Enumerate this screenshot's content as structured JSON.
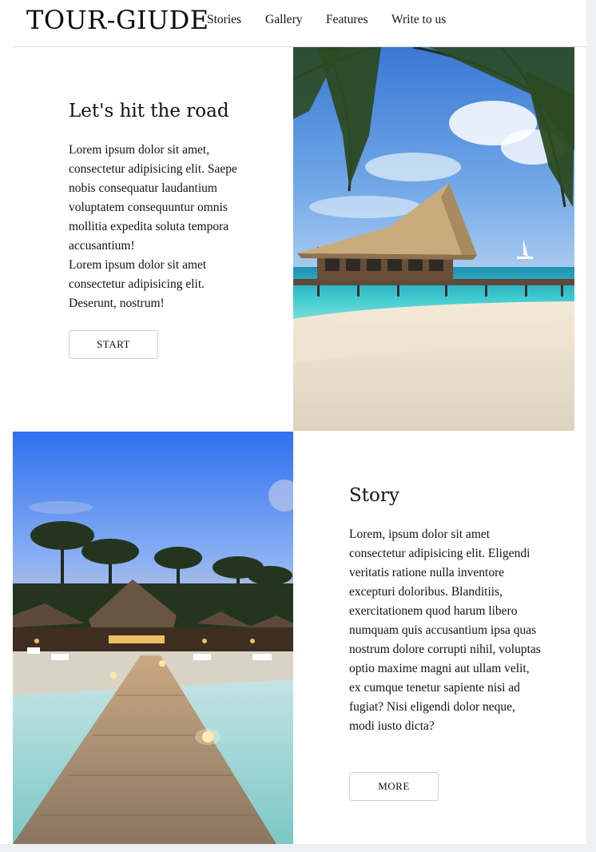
{
  "header": {
    "logo": "TOUR-GIUDE",
    "nav": [
      "Stories",
      "Gallery",
      "Features",
      "Write to us"
    ]
  },
  "hero": {
    "title": "Let's hit the road",
    "body": "Lorem ipsum dolor sit amet, consectetur adipisicing elit. Saepe nobis consequatur laudantium voluptatem consequuntur omnis mollitia expedita soluta tempora accusantium!\nLorem ipsum dolor sit amet consectetur adipisicing elit. Deserunt, nostrum!",
    "button": "START",
    "image": "beach-hut-pier-photo"
  },
  "story": {
    "title": "Story",
    "body": "Lorem, ipsum dolor sit amet consectetur adipisicing elit. Eligendi veritatis ratione nulla inventore excepturi doloribus. Blanditiis, exercitationem quod harum libero numquam quis accusantium ipsa quas nostrum dolore corrupti nihil, voluptas optio maxime magni aut ullam velit, ex cumque tenetur sapiente nisi ad fugiat? Nisi eligendi dolor neque, modi iusto dicta?",
    "button": "MORE",
    "image": "resort-boardwalk-photo"
  },
  "colors": {
    "text": "#111111",
    "border": "#d9d9d9",
    "background": "#ffffff"
  }
}
